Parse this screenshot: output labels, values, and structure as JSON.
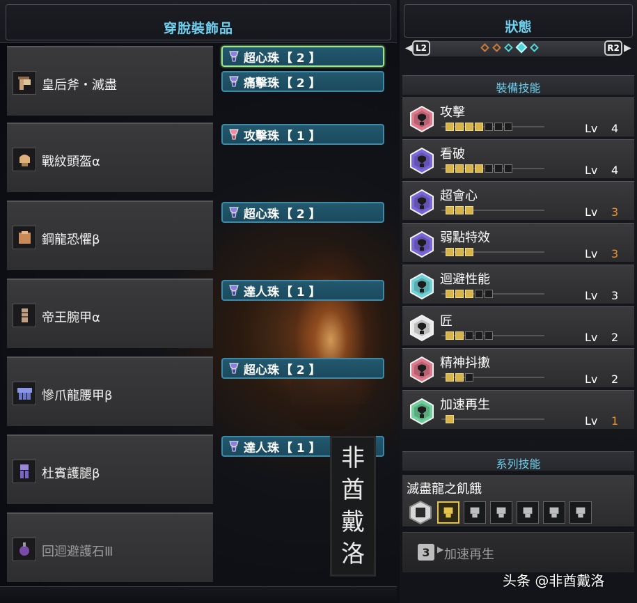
{
  "left_panel": {
    "title": "穿脫裝飾品",
    "equipment": [
      {
        "name": "皇后斧・滅盡",
        "icon": "axe-icon",
        "decorations": [
          {
            "label": "超心珠",
            "size": "【 2 】",
            "gem": "purple",
            "selected": true
          },
          {
            "label": "痛擊珠",
            "size": "【 2 】",
            "gem": "purple",
            "selected": false
          }
        ]
      },
      {
        "name": "戰紋頭盔α",
        "icon": "helmet-icon",
        "decorations": [
          {
            "label": "攻擊珠",
            "size": "【 1 】",
            "gem": "pink",
            "selected": false
          }
        ]
      },
      {
        "name": "鋼龍恐懼β",
        "icon": "chest-armor-icon",
        "decorations": [
          {
            "label": "超心珠",
            "size": "【 2 】",
            "gem": "purple",
            "selected": false
          }
        ]
      },
      {
        "name": "帝王腕甲α",
        "icon": "gauntlet-icon",
        "decorations": [
          {
            "label": "達人珠",
            "size": "【 1 】",
            "gem": "purple",
            "selected": false
          }
        ]
      },
      {
        "name": "慘爪龍腰甲β",
        "icon": "waist-armor-icon",
        "decorations": [
          {
            "label": "超心珠",
            "size": "【 2 】",
            "gem": "purple",
            "selected": false
          }
        ]
      },
      {
        "name": "杜賓護腿β",
        "icon": "leg-armor-icon",
        "decorations": [
          {
            "label": "達人珠",
            "size": "【 1 】",
            "gem": "purple",
            "selected": false
          }
        ]
      },
      {
        "name": "回迴避護石Ⅲ",
        "icon": "charm-icon",
        "dim": true,
        "decorations": []
      }
    ]
  },
  "watermark": {
    "chars": [
      "非",
      "酋",
      "戴",
      "洛"
    ]
  },
  "right_panel": {
    "title": "狀態",
    "nav": {
      "left_button": "L2",
      "right_button": "R2",
      "left_arrow": "◀",
      "right_arrow": "▶"
    },
    "equipped_skills_header": "裝備技能",
    "lv_label": "Lv",
    "skills": [
      {
        "name": "攻擊",
        "level": "4",
        "filled": 4,
        "max": 7,
        "color": "#e0788c",
        "capped": false
      },
      {
        "name": "看破",
        "level": "4",
        "filled": 4,
        "max": 7,
        "color": "#7a66d8",
        "capped": false
      },
      {
        "name": "超會心",
        "level": "3",
        "filled": 3,
        "max": 3,
        "color": "#7a66d8",
        "capped": true
      },
      {
        "name": "弱點特效",
        "level": "3",
        "filled": 3,
        "max": 3,
        "color": "#7a66d8",
        "capped": true
      },
      {
        "name": "迴避性能",
        "level": "3",
        "filled": 3,
        "max": 5,
        "color": "#6fd2d6",
        "capped": false
      },
      {
        "name": "匠",
        "level": "2",
        "filled": 2,
        "max": 5,
        "color": "#e8e8e8",
        "capped": false
      },
      {
        "name": "精神抖擻",
        "level": "2",
        "filled": 2,
        "max": 3,
        "color": "#e0788c",
        "capped": false
      },
      {
        "name": "加速再生",
        "level": "1",
        "filled": 1,
        "max": 1,
        "color": "#6fcf9a",
        "capped": true
      }
    ],
    "set_skills_header": "系列技能",
    "set_skill": {
      "name": "滅盡龍之飢餓",
      "pieces": [
        "weapon-piece-icon",
        "helmet-piece-icon",
        "chest-piece-icon",
        "arm-piece-icon",
        "waist-piece-icon",
        "leg-piece-icon"
      ],
      "active_piece": 0,
      "bonus_count": "3",
      "bonus_arrow": "▶",
      "bonus_name": "加速再生"
    }
  },
  "credit": "头条 @非酋戴洛"
}
